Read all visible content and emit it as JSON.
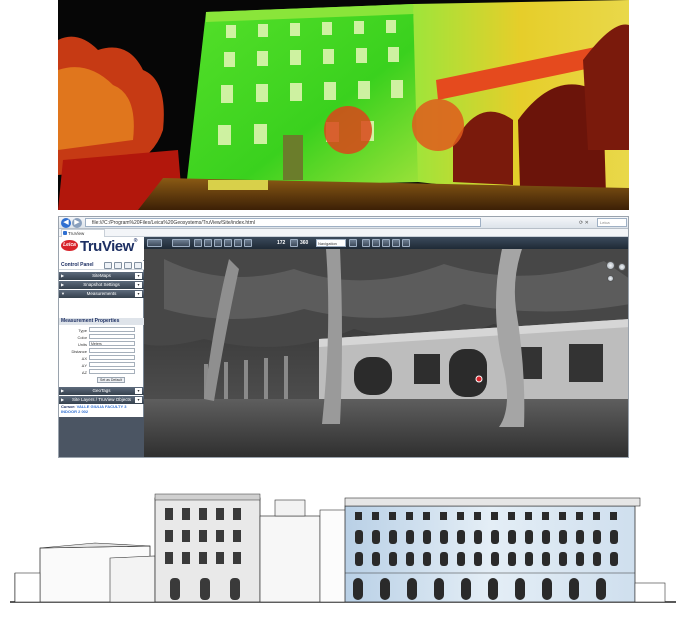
{
  "browser": {
    "address": "file:///C:/Program%20Files/Leica%20Geosystems/TruView/Site/index.html",
    "tab_title": "TruView",
    "search_placeholder": "Leica"
  },
  "app": {
    "logo_text": "Leica",
    "product_name": "TruView",
    "control_panel_title": "Control Panel",
    "accordion": [
      {
        "label": "SiteMaps"
      },
      {
        "label": "Snapshot Settings"
      },
      {
        "label": "Measurements"
      }
    ],
    "accordion_bottom": [
      {
        "label": "GeoTags"
      },
      {
        "label": "Site Layers / TruView Objects"
      }
    ],
    "measurement_properties": {
      "title": "Measurement Properties",
      "fields": [
        {
          "label": "Type",
          "value": ""
        },
        {
          "label": "Color",
          "value": ""
        },
        {
          "label": "Units",
          "value": "Meters"
        },
        {
          "label": "Distance",
          "value": ""
        },
        {
          "label": "ΔX",
          "value": ""
        },
        {
          "label": "ΔY",
          "value": ""
        },
        {
          "label": "ΔZ",
          "value": ""
        }
      ],
      "button_label": "Set as Default"
    },
    "cursor": {
      "label": "Cursor:",
      "value": "VALLE GIULIA FACULTY 3 INDOOR 2 002"
    }
  },
  "toolbar": {
    "zoom_value": "172",
    "fov_value": "360",
    "select_value": "Navigation"
  },
  "colors": {
    "accent": "#1d2f63",
    "leica_red": "#d8242b",
    "panel_dark": "#36414d"
  }
}
